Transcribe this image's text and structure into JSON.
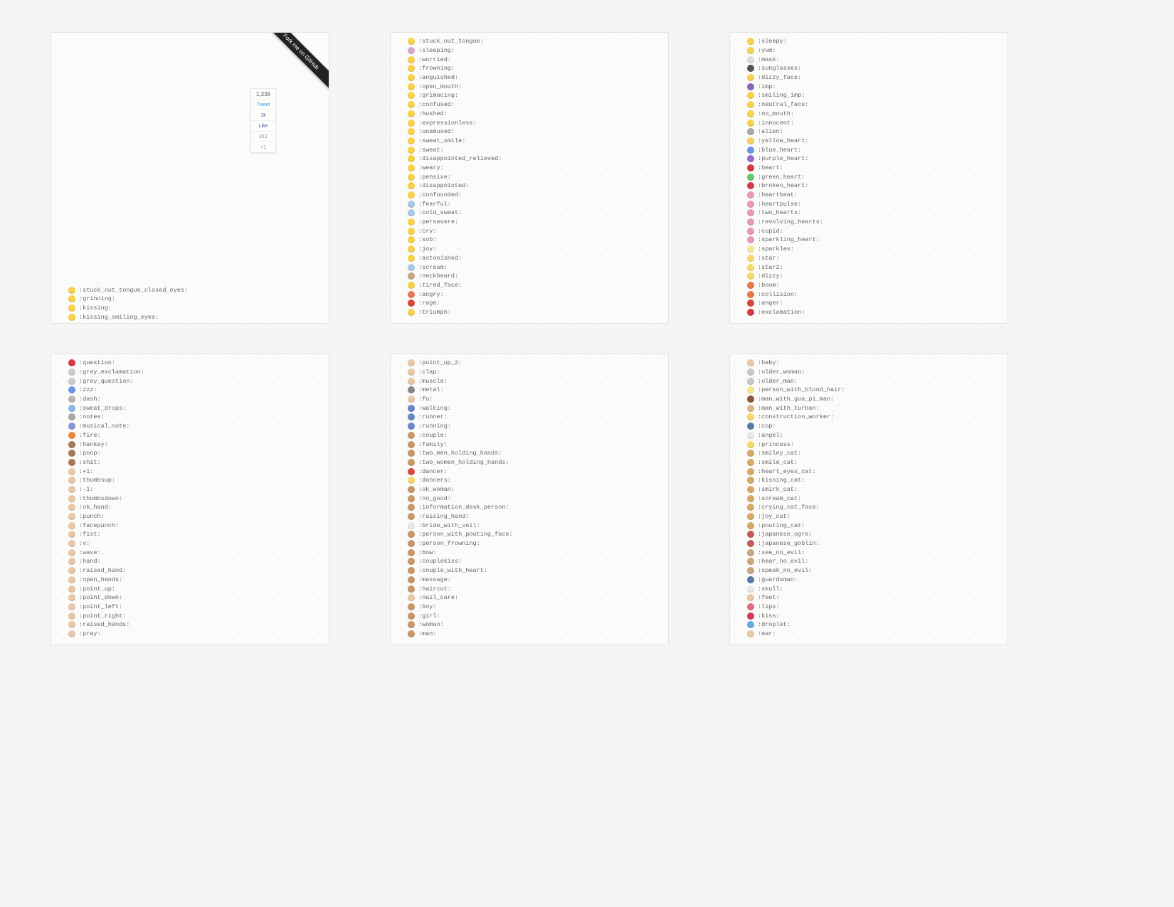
{
  "ribbon_text": "Fork me on GitHub",
  "social": {
    "count_top": "1,336",
    "tweet": "Tweet",
    "fb_like": "Like",
    "fb_count": "1k",
    "gplus_count": "312",
    "gplus_label": "+1"
  },
  "panels": [
    {
      "bottom_items": [
        {
          "icon": "#f8d24a",
          "code": ":stuck_out_tongue_closed_eyes:"
        },
        {
          "icon": "#f8d24a",
          "code": ":grinning:"
        },
        {
          "icon": "#f8d24a",
          "code": ":kissing:"
        },
        {
          "icon": "#f8d24a",
          "code": ":kissing_smiling_eyes:"
        }
      ]
    },
    {
      "items": [
        {
          "icon": "#f8d24a",
          "code": ":stuck_out_tongue:"
        },
        {
          "icon": "#d8a8c8",
          "code": ":sleeping:"
        },
        {
          "icon": "#f8d24a",
          "code": ":worried:"
        },
        {
          "icon": "#f8d24a",
          "code": ":frowning:"
        },
        {
          "icon": "#f8d24a",
          "code": ":anguished:"
        },
        {
          "icon": "#f8d24a",
          "code": ":open_mouth:"
        },
        {
          "icon": "#f8d24a",
          "code": ":grimacing:"
        },
        {
          "icon": "#f8d24a",
          "code": ":confused:"
        },
        {
          "icon": "#f8d24a",
          "code": ":hushed:"
        },
        {
          "icon": "#f8d24a",
          "code": ":expressionless:"
        },
        {
          "icon": "#f8d24a",
          "code": ":unamused:"
        },
        {
          "icon": "#f8d24a",
          "code": ":sweat_smile:"
        },
        {
          "icon": "#f8d24a",
          "code": ":sweat:"
        },
        {
          "icon": "#f8d24a",
          "code": ":disappointed_relieved:"
        },
        {
          "icon": "#f8d24a",
          "code": ":weary:"
        },
        {
          "icon": "#f8d24a",
          "code": ":pensive:"
        },
        {
          "icon": "#f8d24a",
          "code": ":disappointed:"
        },
        {
          "icon": "#f8d24a",
          "code": ":confounded:"
        },
        {
          "icon": "#a8c8e8",
          "code": ":fearful:"
        },
        {
          "icon": "#a8c8e8",
          "code": ":cold_sweat:"
        },
        {
          "icon": "#f8d24a",
          "code": ":persevere:"
        },
        {
          "icon": "#f8d24a",
          "code": ":cry:"
        },
        {
          "icon": "#f8d24a",
          "code": ":sob:"
        },
        {
          "icon": "#f8d24a",
          "code": ":joy:"
        },
        {
          "icon": "#f8d24a",
          "code": ":astonished:"
        },
        {
          "icon": "#a8c8e8",
          "code": ":scream:"
        },
        {
          "icon": "#c8a888",
          "code": ":neckbeard:"
        },
        {
          "icon": "#f8d24a",
          "code": ":tired_face:"
        },
        {
          "icon": "#e87858",
          "code": ":angry:"
        },
        {
          "icon": "#d84838",
          "code": ":rage:"
        },
        {
          "icon": "#f8d24a",
          "code": ":triumph:"
        }
      ]
    },
    {
      "items": [
        {
          "icon": "#f8d24a",
          "code": ":sleepy:"
        },
        {
          "icon": "#f8d24a",
          "code": ":yum:"
        },
        {
          "icon": "#dddddd",
          "code": ":mask:"
        },
        {
          "icon": "#555555",
          "code": ":sunglasses:"
        },
        {
          "icon": "#f8d24a",
          "code": ":dizzy_face:"
        },
        {
          "icon": "#8868b8",
          "code": ":imp:"
        },
        {
          "icon": "#f8d24a",
          "code": ":smiling_imp:"
        },
        {
          "icon": "#f8d24a",
          "code": ":neutral_face:"
        },
        {
          "icon": "#f8d24a",
          "code": ":no_mouth:"
        },
        {
          "icon": "#f8d24a",
          "code": ":innocent:"
        },
        {
          "icon": "#a8a8a8",
          "code": ":alien:"
        },
        {
          "icon": "#f8d060",
          "code": ":yellow_heart:"
        },
        {
          "icon": "#6898e8",
          "code": ":blue_heart:"
        },
        {
          "icon": "#9868c8",
          "code": ":purple_heart:"
        },
        {
          "icon": "#d83848",
          "code": ":heart:"
        },
        {
          "icon": "#68c868",
          "code": ":green_heart:"
        },
        {
          "icon": "#d83848",
          "code": ":broken_heart:"
        },
        {
          "icon": "#e898b8",
          "code": ":heartbeat:"
        },
        {
          "icon": "#e898b8",
          "code": ":heartpulse:"
        },
        {
          "icon": "#e898b8",
          "code": ":two_hearts:"
        },
        {
          "icon": "#e898b8",
          "code": ":revolving_hearts:"
        },
        {
          "icon": "#e898b8",
          "code": ":cupid:"
        },
        {
          "icon": "#e898b8",
          "code": ":sparkling_heart:"
        },
        {
          "icon": "#f8e898",
          "code": ":sparkles:"
        },
        {
          "icon": "#f8d868",
          "code": ":star:"
        },
        {
          "icon": "#f8d868",
          "code": ":star2:"
        },
        {
          "icon": "#f8d868",
          "code": ":dizzy:"
        },
        {
          "icon": "#e87848",
          "code": ":boom:"
        },
        {
          "icon": "#e87848",
          "code": ":collision:"
        },
        {
          "icon": "#d84838",
          "code": ":anger:"
        },
        {
          "icon": "#d83848",
          "code": ":exclamation:"
        }
      ]
    },
    {
      "items": [
        {
          "icon": "#d83848",
          "code": ":question:"
        },
        {
          "icon": "#cccccc",
          "code": ":grey_exclamation:"
        },
        {
          "icon": "#cccccc",
          "code": ":grey_question:"
        },
        {
          "icon": "#6898e8",
          "code": ":zzz:"
        },
        {
          "icon": "#b8b8b8",
          "code": ":dash:"
        },
        {
          "icon": "#88b8e8",
          "code": ":sweat_drops:"
        },
        {
          "icon": "#a8a8a8",
          "code": ":notes:"
        },
        {
          "icon": "#8898d8",
          "code": ":musical_note:"
        },
        {
          "icon": "#f08838",
          "code": ":fire:"
        },
        {
          "icon": "#a87858",
          "code": ":hankey:"
        },
        {
          "icon": "#a87858",
          "code": ":poop:"
        },
        {
          "icon": "#a87858",
          "code": ":shit:"
        },
        {
          "icon": "#e8c8a8",
          "code": ":+1:"
        },
        {
          "icon": "#e8c8a8",
          "code": ":thumbsup:"
        },
        {
          "icon": "#e8c8a8",
          "code": ":-1:"
        },
        {
          "icon": "#e8c8a8",
          "code": ":thumbsdown:"
        },
        {
          "icon": "#e8c8a8",
          "code": ":ok_hand:"
        },
        {
          "icon": "#e8c8a8",
          "code": ":punch:"
        },
        {
          "icon": "#e8c8a8",
          "code": ":facepunch:"
        },
        {
          "icon": "#e8c8a8",
          "code": ":fist:"
        },
        {
          "icon": "#e8c8a8",
          "code": ":v:"
        },
        {
          "icon": "#e8c8a8",
          "code": ":wave:"
        },
        {
          "icon": "#e8c8a8",
          "code": ":hand:"
        },
        {
          "icon": "#e8c8a8",
          "code": ":raised_hand:"
        },
        {
          "icon": "#e8c8a8",
          "code": ":open_hands:"
        },
        {
          "icon": "#e8c8a8",
          "code": ":point_up:"
        },
        {
          "icon": "#e8c8a8",
          "code": ":point_down:"
        },
        {
          "icon": "#e8c8a8",
          "code": ":point_left:"
        },
        {
          "icon": "#e8c8a8",
          "code": ":point_right:"
        },
        {
          "icon": "#e8c8a8",
          "code": ":raised_hands:"
        },
        {
          "icon": "#e8c8a8",
          "code": ":pray:"
        }
      ]
    },
    {
      "items": [
        {
          "icon": "#e8c8a8",
          "code": ":point_up_2:"
        },
        {
          "icon": "#e8c8a8",
          "code": ":clap:"
        },
        {
          "icon": "#e8c8a8",
          "code": ":muscle:"
        },
        {
          "icon": "#888888",
          "code": ":metal:"
        },
        {
          "icon": "#e8c8a8",
          "code": ":fu:"
        },
        {
          "icon": "#6888c8",
          "code": ":walking:"
        },
        {
          "icon": "#6888c8",
          "code": ":runner:"
        },
        {
          "icon": "#6888c8",
          "code": ":running:"
        },
        {
          "icon": "#c89868",
          "code": ":couple:"
        },
        {
          "icon": "#c89868",
          "code": ":family:"
        },
        {
          "icon": "#c89868",
          "code": ":two_men_holding_hands:"
        },
        {
          "icon": "#c89868",
          "code": ":two_women_holding_hands:"
        },
        {
          "icon": "#d84848",
          "code": ":dancer:"
        },
        {
          "icon": "#f8d868",
          "code": ":dancers:"
        },
        {
          "icon": "#c89868",
          "code": ":ok_woman:"
        },
        {
          "icon": "#c89868",
          "code": ":no_good:"
        },
        {
          "icon": "#c89868",
          "code": ":information_desk_person:"
        },
        {
          "icon": "#c89868",
          "code": ":raising_hand:"
        },
        {
          "icon": "#e8e8e8",
          "code": ":bride_with_veil:"
        },
        {
          "icon": "#c89868",
          "code": ":person_with_pouting_face:"
        },
        {
          "icon": "#c89868",
          "code": ":person_frowning:"
        },
        {
          "icon": "#c89868",
          "code": ":bow:"
        },
        {
          "icon": "#c89868",
          "code": ":couplekiss:"
        },
        {
          "icon": "#c89868",
          "code": ":couple_with_heart:"
        },
        {
          "icon": "#c89868",
          "code": ":massage:"
        },
        {
          "icon": "#c89868",
          "code": ":haircut:"
        },
        {
          "icon": "#e8c8a8",
          "code": ":nail_care:"
        },
        {
          "icon": "#c89868",
          "code": ":boy:"
        },
        {
          "icon": "#c89868",
          "code": ":girl:"
        },
        {
          "icon": "#c89868",
          "code": ":woman:"
        },
        {
          "icon": "#c89868",
          "code": ":man:"
        }
      ]
    },
    {
      "items": [
        {
          "icon": "#e8c8a8",
          "code": ":baby:"
        },
        {
          "icon": "#c8c8c8",
          "code": ":older_woman:"
        },
        {
          "icon": "#c8c8c8",
          "code": ":older_man:"
        },
        {
          "icon": "#f8e888",
          "code": ":person_with_blond_hair:"
        },
        {
          "icon": "#885838",
          "code": ":man_with_gua_pi_mao:"
        },
        {
          "icon": "#d8b888",
          "code": ":man_with_turban:"
        },
        {
          "icon": "#f8d868",
          "code": ":construction_worker:"
        },
        {
          "icon": "#5878a8",
          "code": ":cop:"
        },
        {
          "icon": "#e8e8e8",
          "code": ":angel:"
        },
        {
          "icon": "#f8d868",
          "code": ":princess:"
        },
        {
          "icon": "#d8a868",
          "code": ":smiley_cat:"
        },
        {
          "icon": "#d8a868",
          "code": ":smile_cat:"
        },
        {
          "icon": "#d8a868",
          "code": ":heart_eyes_cat:"
        },
        {
          "icon": "#d8a868",
          "code": ":kissing_cat:"
        },
        {
          "icon": "#d8a868",
          "code": ":smirk_cat:"
        },
        {
          "icon": "#d8a868",
          "code": ":scream_cat:"
        },
        {
          "icon": "#d8a868",
          "code": ":crying_cat_face:"
        },
        {
          "icon": "#d8a868",
          "code": ":joy_cat:"
        },
        {
          "icon": "#d8a868",
          "code": ":pouting_cat:"
        },
        {
          "icon": "#c85858",
          "code": ":japanese_ogre:"
        },
        {
          "icon": "#c85858",
          "code": ":japanese_goblin:"
        },
        {
          "icon": "#c8a878",
          "code": ":see_no_evil:"
        },
        {
          "icon": "#c8a878",
          "code": ":hear_no_evil:"
        },
        {
          "icon": "#c8a878",
          "code": ":speak_no_evil:"
        },
        {
          "icon": "#5878a8",
          "code": ":guardsman:"
        },
        {
          "icon": "#e8e8e8",
          "code": ":skull:"
        },
        {
          "icon": "#e8c8a8",
          "code": ":feet:"
        },
        {
          "icon": "#e86888",
          "code": ":lips:"
        },
        {
          "icon": "#d83858",
          "code": ":kiss:"
        },
        {
          "icon": "#68a8e8",
          "code": ":droplet:"
        },
        {
          "icon": "#e8c8a8",
          "code": ":ear:"
        }
      ]
    }
  ]
}
